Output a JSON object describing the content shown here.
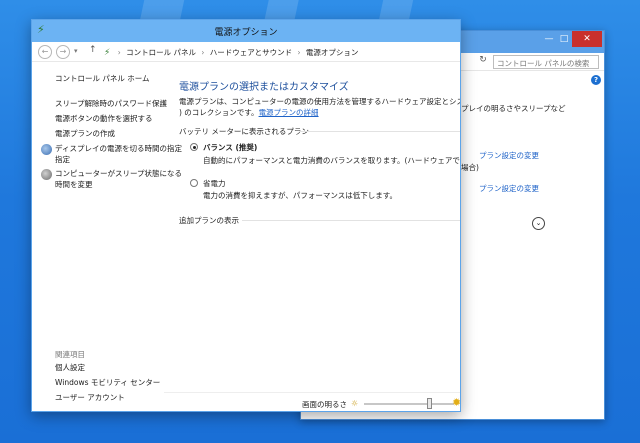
{
  "window": {
    "title": "電源オプション"
  },
  "nav": {
    "back_symbol": "←",
    "forward_symbol": "→",
    "dropdown_symbol": "▾",
    "up_symbol": "↑",
    "breadcrumb": [
      "コントロール パネル",
      "ハードウェアとサウンド",
      "電源オプション"
    ],
    "separator": "›"
  },
  "back_window": {
    "min_symbol": "—",
    "max_symbol": "□",
    "close_symbol": "✕",
    "refresh_symbol": "↻",
    "search_placeholder": "コントロール パネルの検索",
    "help_symbol": "?",
    "text_brightness": "プレイの明るさやスリープなど",
    "text_plan_settings_1": "プラン設定の変更",
    "text_paren": "場合)",
    "text_plan_settings_2": "プラン設定の変更"
  },
  "sidebar": {
    "home": "コントロール パネル ホーム",
    "items": [
      "スリープ解除時のパスワード保護",
      "電源ボタンの動作を選択する",
      "電源プランの作成",
      "ディスプレイの電源を切る時間の指定",
      "コンピューターがスリープ状態になる",
      "時間を変更"
    ],
    "see_also": "関連項目",
    "see_also_items": [
      "個人設定",
      "Windows モビリティ センター",
      "ユーザー アカウント"
    ]
  },
  "main": {
    "heading": "電源プランの選択またはカスタマイズ",
    "description_1": "電源プランは、コンピューターの電源の使用方法を管理するハードウェア設定とシステム設定 (ディ",
    "description_2": ") のコレクションです。",
    "description_link": "電源プランの詳細",
    "battery_header": "バッテリ メーターに表示されるプラン",
    "plans": [
      {
        "name": "バランス (推奨)",
        "description": "自動的にパフォーマンスと電力消費のバランスを取ります。(ハードウェアでサポートされてい",
        "selected": true
      },
      {
        "name": "省電力",
        "description": "電力の消費を抑えますが、パフォーマンスは低下します。",
        "selected": false
      }
    ],
    "extra_header": "追加プランの表示",
    "expand_symbol": "⌄"
  },
  "bottom": {
    "brightness_label": "画面の明るさ",
    "brightness_low_symbol": "☼",
    "brightness_high_symbol": "✹",
    "brightness_level": 0.73
  },
  "colors": {
    "desktop": "#1f78dc",
    "titlebar": "#6cb3f3",
    "close_button": "#c9302c",
    "link": "#1f63c8",
    "heading": "#1d4f9c"
  }
}
